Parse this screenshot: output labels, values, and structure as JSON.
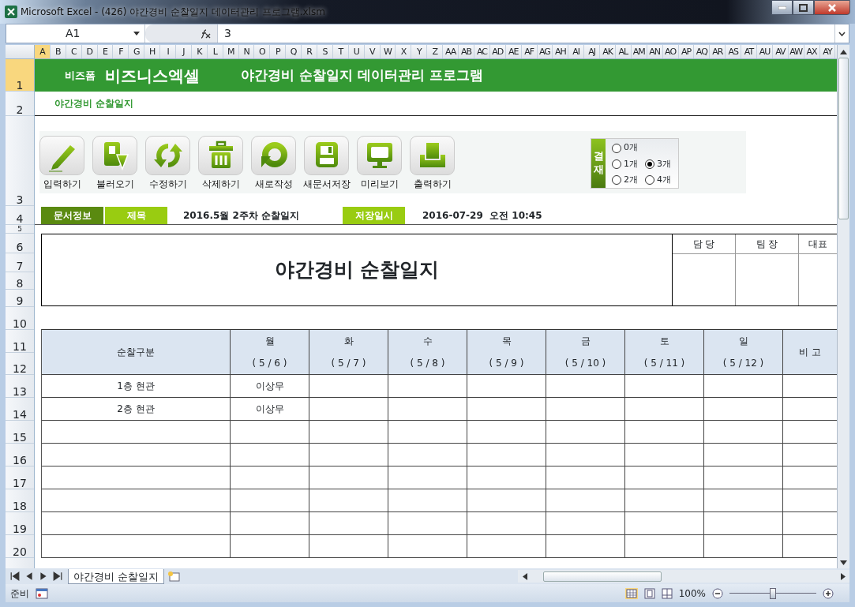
{
  "window": {
    "title": "Microsoft Excel - (426) 야간경비 순찰일지 데이터관리 프로그램.xlsm"
  },
  "formula_bar": {
    "name_box": "A1",
    "value": "3"
  },
  "column_headers": [
    {
      "label": "A",
      "selected": true
    },
    {
      "label": "B",
      "selected": false
    },
    {
      "label": "C",
      "selected": false
    },
    {
      "label": "D",
      "selected": false
    },
    {
      "label": "E",
      "selected": false
    },
    {
      "label": "F",
      "selected": false
    },
    {
      "label": "G",
      "selected": false
    },
    {
      "label": "H",
      "selected": false
    },
    {
      "label": "I",
      "selected": false
    },
    {
      "label": "J",
      "selected": false
    },
    {
      "label": "K",
      "selected": false
    },
    {
      "label": "L",
      "selected": false
    },
    {
      "label": "M",
      "selected": false
    },
    {
      "label": "N",
      "selected": false
    },
    {
      "label": "O",
      "selected": false
    },
    {
      "label": "P",
      "selected": false
    },
    {
      "label": "Q",
      "selected": false
    },
    {
      "label": "R",
      "selected": false
    },
    {
      "label": "S",
      "selected": false
    },
    {
      "label": "T",
      "selected": false
    },
    {
      "label": "U",
      "selected": false
    },
    {
      "label": "V",
      "selected": false
    },
    {
      "label": "W",
      "selected": false
    },
    {
      "label": "X",
      "selected": false
    },
    {
      "label": "Y",
      "selected": false
    },
    {
      "label": "Z",
      "selected": false
    },
    {
      "label": "AA",
      "selected": false
    },
    {
      "label": "AB",
      "selected": false
    },
    {
      "label": "AC",
      "selected": false
    },
    {
      "label": "AD",
      "selected": false
    },
    {
      "label": "AE",
      "selected": false
    },
    {
      "label": "AF",
      "selected": false
    },
    {
      "label": "AG",
      "selected": false
    },
    {
      "label": "AH",
      "selected": false
    },
    {
      "label": "AI",
      "selected": false
    },
    {
      "label": "AJ",
      "selected": false
    },
    {
      "label": "AK",
      "selected": false
    },
    {
      "label": "AL",
      "selected": false
    },
    {
      "label": "AM",
      "selected": false
    },
    {
      "label": "AN",
      "selected": false
    },
    {
      "label": "AO",
      "selected": false
    },
    {
      "label": "AP",
      "selected": false
    },
    {
      "label": "AQ",
      "selected": false
    },
    {
      "label": "AR",
      "selected": false
    },
    {
      "label": "AS",
      "selected": false
    },
    {
      "label": "AT",
      "selected": false
    },
    {
      "label": "AU",
      "selected": false
    },
    {
      "label": "AV",
      "selected": false
    },
    {
      "label": "AW",
      "selected": false
    },
    {
      "label": "AX",
      "selected": false
    },
    {
      "label": "AY",
      "selected": false
    }
  ],
  "row_headers": [
    {
      "label": "1",
      "selected": true
    },
    {
      "label": "2",
      "selected": false
    },
    {
      "label": "3",
      "selected": false
    },
    {
      "label": "4",
      "selected": false
    },
    {
      "label": "5",
      "selected": false
    },
    {
      "label": "6",
      "selected": false
    },
    {
      "label": "7",
      "selected": false
    },
    {
      "label": "8",
      "selected": false
    },
    {
      "label": "9",
      "selected": false
    },
    {
      "label": "10",
      "selected": false
    },
    {
      "label": "11",
      "selected": false
    },
    {
      "label": "12",
      "selected": false
    },
    {
      "label": "13",
      "selected": false
    },
    {
      "label": "14",
      "selected": false
    },
    {
      "label": "15",
      "selected": false
    },
    {
      "label": "16",
      "selected": false
    },
    {
      "label": "17",
      "selected": false
    },
    {
      "label": "18",
      "selected": false
    },
    {
      "label": "19",
      "selected": false
    },
    {
      "label": "20",
      "selected": false
    }
  ],
  "banner": {
    "brand_small": "비즈폼",
    "brand": "비즈니스엑셀",
    "title": "야간경비 순찰일지 데이터관리 프로그램"
  },
  "subtitle": "야간경비 순찰일지",
  "toolbar": [
    {
      "label": "입력하기",
      "kind": "pencil"
    },
    {
      "label": "불러오기",
      "kind": "load"
    },
    {
      "label": "수정하기",
      "kind": "refresh"
    },
    {
      "label": "삭제하기",
      "kind": "trash"
    },
    {
      "label": "새로작성",
      "kind": "new"
    },
    {
      "label": "새문서저장",
      "kind": "save"
    },
    {
      "label": "미리보기",
      "kind": "monitor"
    },
    {
      "label": "출력하기",
      "kind": "print"
    }
  ],
  "approval": {
    "label": "결재",
    "options": [
      {
        "label": "0개",
        "selected": false
      },
      {
        "label": "1개",
        "selected": false
      },
      {
        "label": "3개",
        "selected": true
      },
      {
        "label": "2개",
        "selected": false
      },
      {
        "label": "4개",
        "selected": false
      }
    ]
  },
  "doc_info": {
    "section": "문서정보",
    "title_label": "제목",
    "title_value": "2016.5월 2주차 순찰일지",
    "saved_label": "저장일시",
    "saved_value": "2016-07-29  오전 10:45"
  },
  "form": {
    "heading": "야간경비 순찰일지",
    "signoff": [
      "담 당",
      "팀 장",
      "대표"
    ]
  },
  "table": {
    "first_column": "순찰구분",
    "days": [
      {
        "day": "월",
        "date": "( 5 / 6 )"
      },
      {
        "day": "화",
        "date": "( 5 / 7 )"
      },
      {
        "day": "수",
        "date": "( 5 / 8 )"
      },
      {
        "day": "목",
        "date": "( 5 / 9 )"
      },
      {
        "day": "금",
        "date": "( 5 / 10 )"
      },
      {
        "day": "토",
        "date": "( 5 / 11 )"
      },
      {
        "day": "일",
        "date": "( 5 / 12 )"
      }
    ],
    "last_column": "비  고",
    "rows": [
      {
        "area": "1층 현관",
        "values": [
          "이상무"
        ]
      },
      {
        "area": "2층 현관",
        "values": [
          "이상무"
        ]
      }
    ]
  },
  "sheet_tabs": [
    {
      "label": "야간경비 순찰일지",
      "selected": true
    }
  ],
  "status_bar": {
    "status": "준비",
    "zoom": "100%",
    "level": 0.5
  }
}
